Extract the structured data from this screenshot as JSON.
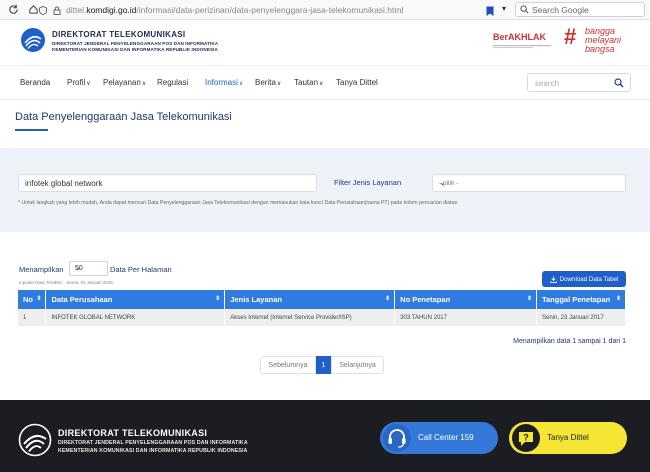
{
  "browser": {
    "url_prefix": "dittel.",
    "url_domain": "komdigi.go.id",
    "url_path": "/informasi/data-perizinan/data-penyelenggara-jasa-telekomunikasi.html",
    "search_placeholder": "Search Google"
  },
  "header": {
    "brand_title": "DIREKTORAT TELEKOMUNIKASI",
    "brand_line1": "DIREKTORAT JENDERAL PENYELENGGARAAN POS DAN INFORMATIKA",
    "brand_line2": "KEMENTERIAN KOMUNIKASI DAN INFORMATIKA REPUBLIK INDONESIA",
    "berakhlak": "BerAKHLAK",
    "bangga_hash": "#",
    "bangga_1": "bangga",
    "bangga_2": "melayani",
    "bangga_3": "bangsa"
  },
  "nav": {
    "items": [
      "Beranda",
      "Profil",
      "Pelayanan",
      "Regulasi",
      "Informasi",
      "Berita",
      "Tautan",
      "Tanya Dittel"
    ],
    "search_placeholder": "search"
  },
  "page": {
    "title": "Data Penyelenggaraan Jasa Telekomunikasi"
  },
  "filter": {
    "search_value": "infotek global network",
    "jenis_label": "Filter Jenis Layanan",
    "jenis_selected": "- pilih -",
    "note": "* Untuk langkah yang lebih mudah, Anda dapat mencari Data Penyelenggaraan Jasa Telekomunikasi dengan memasukan kata kunci Data Perusahaan(nama PT) pada kolom pencarian diatas"
  },
  "table": {
    "show_label": "Menampilkan",
    "per_page": "50",
    "per_label": "Data Per Halaman",
    "last_input": "Inputan Data Terakhir : Jumat, 03 Januari 2025",
    "download_label": "Download Data Tabel",
    "headers": [
      "No",
      "Data Perusahaan",
      "Jenis Layanan",
      "No Penetapan",
      "Tanggal Penetapan"
    ],
    "rows": [
      [
        "1",
        "INFOTEK GLOBAL NETWORK",
        "Akses Internet (Internet Service Provider/ISP)",
        "303 TAHUN 2017",
        "Senin, 23 Januari 2017"
      ]
    ],
    "info": "Menampilkan data 1 sampai 1 dari 1",
    "prev": "Sebelumnya",
    "page": "1",
    "next": "Selanjutnya"
  },
  "footer": {
    "title": "DIREKTORAT TELEKOMUNIKASI",
    "line1": "DIREKTORAT JENDERAL PENYELENGGARAAN POS DAN INFORMATIKA",
    "line2": "KEMENTERIAN KOMUNIKASI DAN INFORMATIKA REPUBLIK INDONESIA",
    "call_center": "Call Center 159",
    "tanya": "Tanya Dittel"
  },
  "colors": {
    "accent": "#1e60c8",
    "table_header": "#2f7be0",
    "footer_bg": "#1c1d22",
    "call_btn": "#3478d9",
    "tanya_btn": "#f4e633",
    "brand_red": "#d32f2f"
  }
}
